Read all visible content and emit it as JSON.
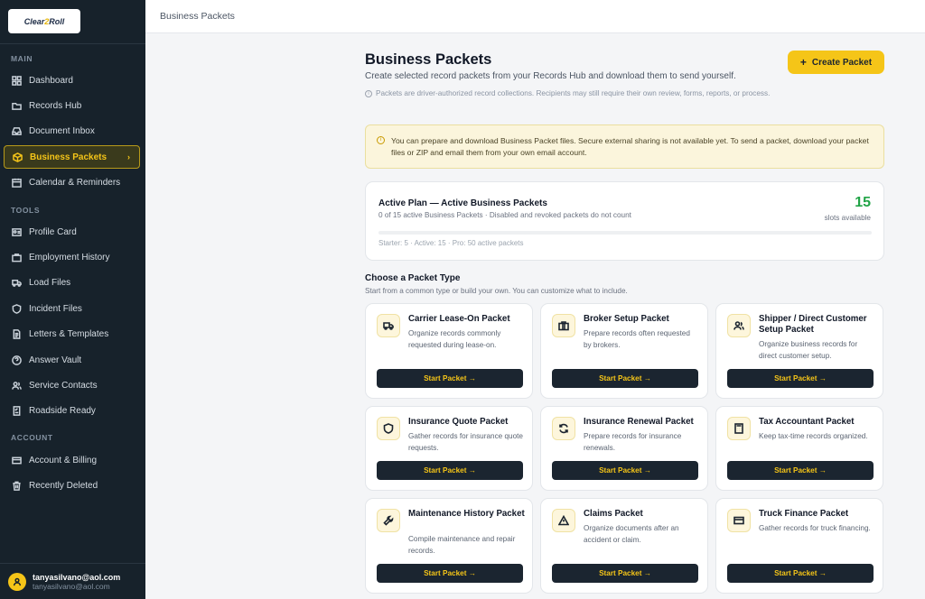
{
  "brand": {
    "logo_main": "Clear",
    "logo_accent": "2",
    "logo_end": "Roll"
  },
  "sidebar": {
    "sections": {
      "main": "MAIN",
      "tools": "TOOLS",
      "account": "ACCOUNT"
    },
    "items": [
      {
        "label": "Dashboard",
        "icon": "grid-icon"
      },
      {
        "label": "Records Hub",
        "icon": "folder-icon"
      },
      {
        "label": "Document Inbox",
        "icon": "inbox-icon"
      },
      {
        "label": "Business Packets",
        "icon": "box-icon",
        "active": true
      },
      {
        "label": "Calendar & Reminders",
        "icon": "calendar-icon"
      },
      {
        "label": "Profile Card",
        "icon": "id-card-icon"
      },
      {
        "label": "Employment History",
        "icon": "briefcase-icon"
      },
      {
        "label": "Load Files",
        "icon": "truck-icon"
      },
      {
        "label": "Incident Files",
        "icon": "shield-icon"
      },
      {
        "label": "Letters & Templates",
        "icon": "document-icon"
      },
      {
        "label": "Answer Vault",
        "icon": "question-icon"
      },
      {
        "label": "Service Contacts",
        "icon": "contacts-icon"
      },
      {
        "label": "Roadside Ready",
        "icon": "checklist-icon"
      },
      {
        "label": "Account & Billing",
        "icon": "card-icon"
      },
      {
        "label": "Recently Deleted",
        "icon": "trash-icon"
      }
    ],
    "chevron": "›",
    "user": {
      "name": "tanyasilvano@aol.com",
      "email": "tanyasilvano@aol.com"
    }
  },
  "topbar": {
    "breadcrumb": "Business Packets"
  },
  "header": {
    "title": "Business Packets",
    "subtitle": "Create selected record packets from your Records Hub and download them to send yourself.",
    "note": "Packets are driver-authorized record collections. Recipients may still require their own review, forms, reports, or process.",
    "create_label": "Create Packet",
    "create_plus": "+"
  },
  "notice": {
    "text": "You can prepare and download Business Packet files. Secure external sharing is not available yet. To send a packet, download your packet files or ZIP and email them from your own email account."
  },
  "plan": {
    "title": "Active Plan — Active Business Packets",
    "subtitle": "0 of 15 active Business Packets · Disabled and revoked packets do not count",
    "count": "15",
    "count_label": "slots available",
    "used_fraction": 0,
    "tiers": "Starter: 5 · Active: 15 · Pro: 50 active packets"
  },
  "choose": {
    "title": "Choose a Packet Type",
    "subtitle": "Start from a common type or build your own. You can customize what to include."
  },
  "start_label": "Start Packet →",
  "packets": [
    {
      "title": "Carrier Lease-On Packet",
      "desc": "Organize records commonly requested during lease-on.",
      "icon": "truck-icon"
    },
    {
      "title": "Broker Setup Packet",
      "desc": "Prepare records often requested by brokers.",
      "icon": "briefcase-icon"
    },
    {
      "title": "Shipper / Direct Customer Setup Packet",
      "desc": "Organize business records for direct customer setup.",
      "icon": "users-icon"
    },
    {
      "title": "Insurance Quote Packet",
      "desc": "Gather records for insurance quote requests.",
      "icon": "shield-icon"
    },
    {
      "title": "Insurance Renewal Packet",
      "desc": "Prepare records for insurance renewals.",
      "icon": "refresh-icon"
    },
    {
      "title": "Tax Accountant Packet",
      "desc": "Keep tax-time records organized.",
      "icon": "calculator-icon"
    },
    {
      "title": "Maintenance History Packet",
      "desc": "Compile maintenance and repair records.",
      "icon": "wrench-icon"
    },
    {
      "title": "Claims Packet",
      "desc": "Organize documents after an accident or claim.",
      "icon": "warning-icon"
    },
    {
      "title": "Truck Finance Packet",
      "desc": "Gather records for truck financing.",
      "icon": "card-icon"
    }
  ],
  "colors": {
    "sidebar_bg": "#17222b",
    "accent": "#f5c518",
    "success": "#22a447",
    "button_dark": "#1b2530"
  }
}
